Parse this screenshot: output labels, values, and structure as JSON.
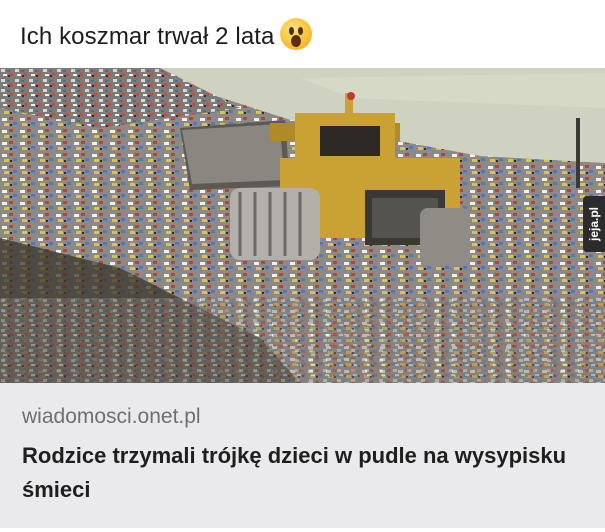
{
  "post": {
    "title": "Ich koszmar trwał 2 lata",
    "title_emoji_icon": "surprised-face-emoji-icon"
  },
  "article": {
    "source": "wiadomosci.onet.pl",
    "headline": "Rodzice trzymali trójkę dzieci w pudle na wysypisku śmieci",
    "image_alt_icon": "landfill-bulldozer-photo"
  },
  "watermark": {
    "text": "jeja.pl"
  },
  "colors": {
    "caption_bg": "#eaeaec",
    "source_text": "#6f6f73",
    "headline_text": "#1f1f1f",
    "bulldozer_yellow": "#c9a233"
  }
}
